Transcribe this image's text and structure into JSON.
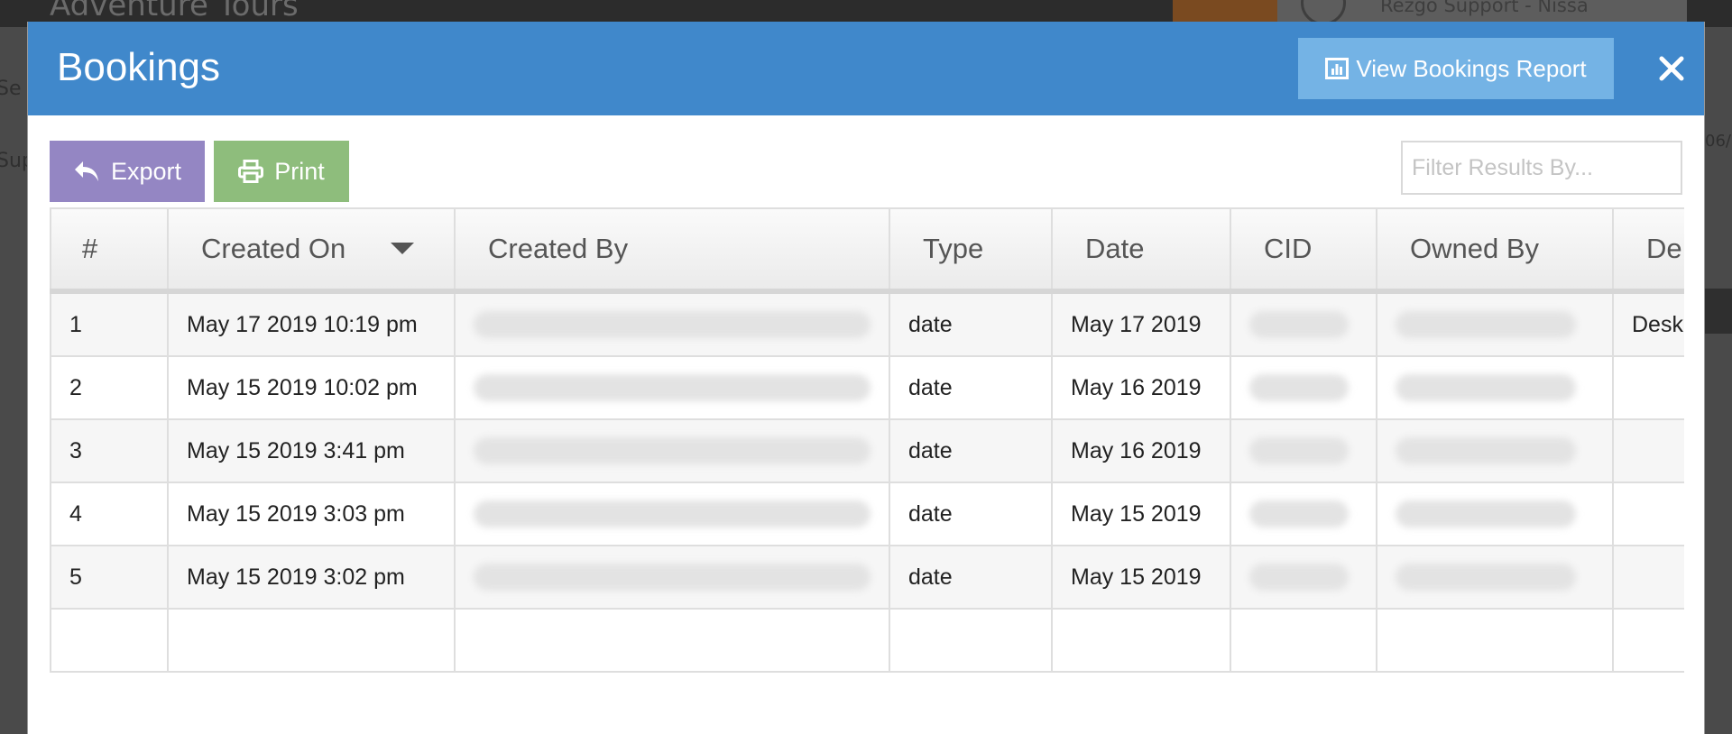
{
  "modal": {
    "title": "Bookings",
    "report_button": "View Bookings Report",
    "colors": {
      "header": "#4088cb",
      "report_button": "#74b3e5",
      "export": "#9486c3",
      "print": "#8ebd7c"
    }
  },
  "toolbar": {
    "export_label": "Export",
    "print_label": "Print",
    "filter_placeholder": "Filter Results By..."
  },
  "table": {
    "columns": [
      "#",
      "Created On",
      "Created By",
      "Type",
      "Date",
      "CID",
      "Owned By",
      "De"
    ],
    "rows": [
      {
        "num": "1",
        "created_on": "May 17 2019 10:19 pm",
        "type": "date",
        "date": "May 17 2019",
        "desc": "Desk"
      },
      {
        "num": "2",
        "created_on": "May 15 2019 10:02 pm",
        "type": "date",
        "date": "May 16 2019",
        "desc": ""
      },
      {
        "num": "3",
        "created_on": "May 15 2019 3:41 pm",
        "type": "date",
        "date": "May 16 2019",
        "desc": ""
      },
      {
        "num": "4",
        "created_on": "May 15 2019 3:03 pm",
        "type": "date",
        "date": "May 15 2019",
        "desc": ""
      },
      {
        "num": "5",
        "created_on": "May 15 2019 3:02 pm",
        "type": "date",
        "date": "May 15 2019",
        "desc": ""
      }
    ]
  }
}
